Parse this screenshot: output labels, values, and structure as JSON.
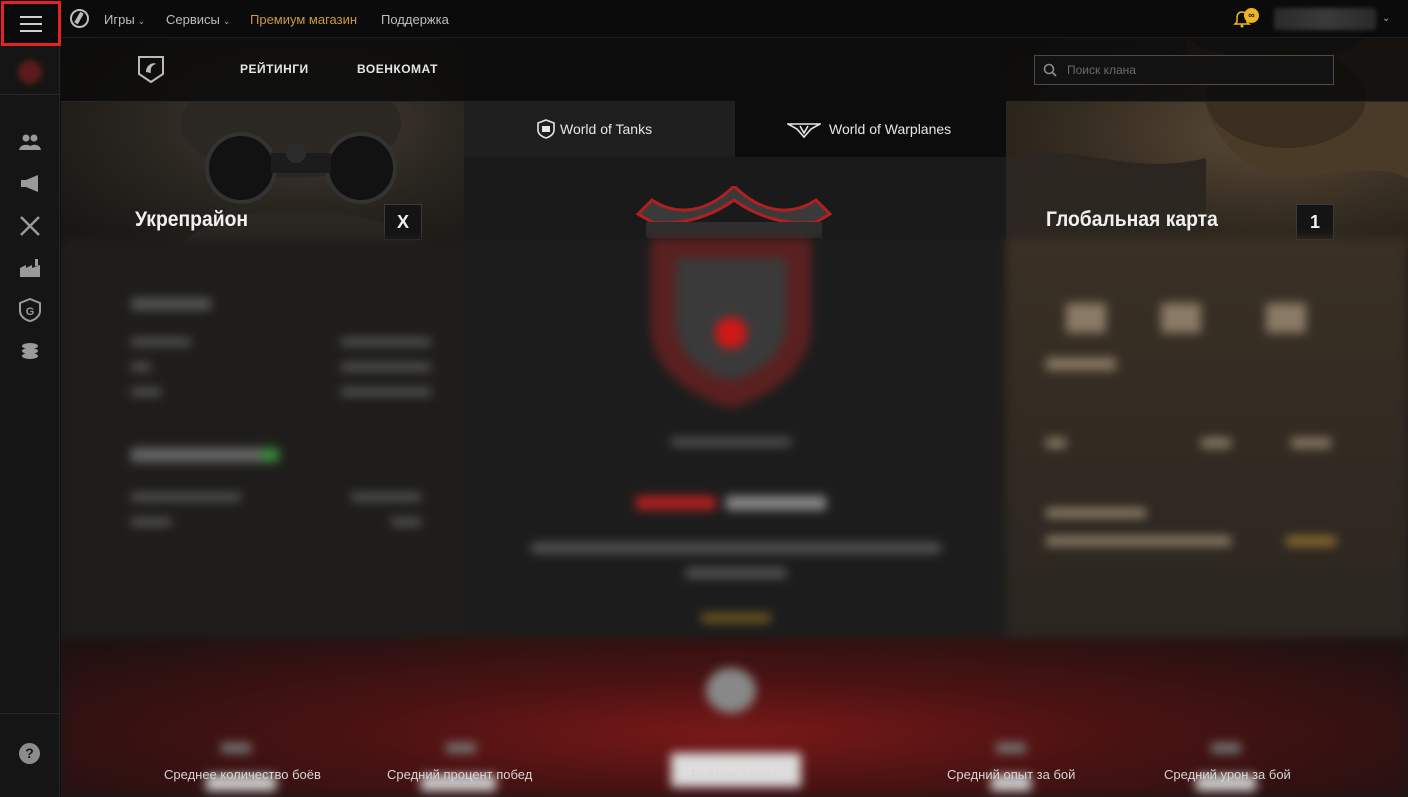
{
  "topbar": {
    "menu_icon": "hamburger-icon",
    "logo_icon": "wargaming-logo-icon",
    "nav": {
      "games": "Игры",
      "services": "Сервисы",
      "premium": "Премиум магазин",
      "support": "Поддержка"
    },
    "notification_icon": "bell-icon",
    "notification_badge": "∞",
    "accent_color": "#c89a45",
    "highlight_color": "#e02424"
  },
  "sidebar": {
    "items": [
      {
        "icon": "clan-avatar-icon"
      },
      {
        "icon": "members-icon"
      },
      {
        "icon": "megaphone-icon"
      },
      {
        "icon": "crossed-swords-icon"
      },
      {
        "icon": "factory-icon"
      },
      {
        "icon": "shield-g-icon"
      },
      {
        "icon": "coins-stack-icon"
      }
    ],
    "help_label": "?"
  },
  "clan_nav": {
    "ratings": "РЕЙТИНГИ",
    "recruitment": "ВОЕНКОМАТ",
    "search_placeholder": "Поиск клана"
  },
  "game_tabs": [
    {
      "label": "World of Tanks",
      "icon": "wot-icon",
      "active": true
    },
    {
      "label": "World of Warplanes",
      "icon": "wowp-icon",
      "active": false
    }
  ],
  "panels": {
    "fort": {
      "title": "Укрепрайон",
      "level": "X"
    },
    "global_map": {
      "title": "Глобальная карта",
      "level": "1"
    }
  },
  "stats": {
    "battles": "Среднее количество боёв",
    "winrate": "Средний процент побед",
    "rating": "Рейтинг клана",
    "exp": "Средний опыт за бой",
    "damage": "Средний урон за бой"
  }
}
